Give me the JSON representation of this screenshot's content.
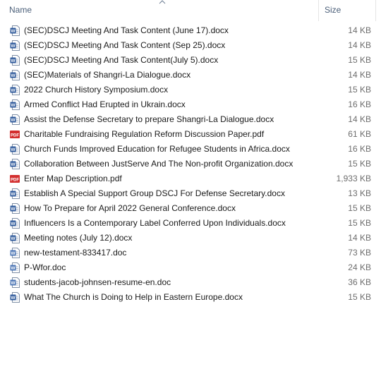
{
  "header": {
    "name_label": "Name",
    "size_label": "Size"
  },
  "files": [
    {
      "name": "(SEC)DSCJ Meeting And Task Content (June 17).docx",
      "size": "14 KB",
      "icon": "word-docx-icon"
    },
    {
      "name": "(SEC)DSCJ Meeting And Task Content (Sep 25).docx",
      "size": "14 KB",
      "icon": "word-docx-icon"
    },
    {
      "name": "(SEC)DSCJ Meeting And Task Content(July 5).docx",
      "size": "15 KB",
      "icon": "word-docx-icon"
    },
    {
      "name": "(SEC)Materials of Shangri-La Dialogue.docx",
      "size": "14 KB",
      "icon": "word-docx-icon"
    },
    {
      "name": "2022 Church History Symposium.docx",
      "size": "15 KB",
      "icon": "word-docx-icon"
    },
    {
      "name": "Armed Conflict Had Erupted in Ukrain.docx",
      "size": "16 KB",
      "icon": "word-docx-icon"
    },
    {
      "name": "Assist the Defense Secretary to prepare Shangri-La Dialogue.docx",
      "size": "14 KB",
      "icon": "word-docx-icon"
    },
    {
      "name": "Charitable Fundraising Regulation Reform Discussion Paper.pdf",
      "size": "61 KB",
      "icon": "pdf-icon"
    },
    {
      "name": "Church Funds Improved Education for Refugee Students in Africa.docx",
      "size": "16 KB",
      "icon": "word-docx-icon"
    },
    {
      "name": "Collaboration Between JustServe And The Non-profit Organization.docx",
      "size": "15 KB",
      "icon": "word-docx-icon"
    },
    {
      "name": "Enter Map Description.pdf",
      "size": "1,933 KB",
      "icon": "pdf-icon"
    },
    {
      "name": "Establish A Special Support Group DSCJ For Defense Secretary.docx",
      "size": "13 KB",
      "icon": "word-docx-icon"
    },
    {
      "name": "How To Prepare for April 2022 General Conference.docx",
      "size": "15 KB",
      "icon": "word-docx-icon"
    },
    {
      "name": "Influencers Is a Contemporary Label Conferred Upon Individuals.docx",
      "size": "15 KB",
      "icon": "word-docx-icon"
    },
    {
      "name": "Meeting notes (July 12).docx",
      "size": "14 KB",
      "icon": "word-docx-icon"
    },
    {
      "name": "new-testament-833417.doc",
      "size": "73 KB",
      "icon": "word-doc-icon"
    },
    {
      "name": "P-Wfor.doc",
      "size": "24 KB",
      "icon": "word-doc-icon"
    },
    {
      "name": "students-jacob-johnsen-resume-en.doc",
      "size": "36 KB",
      "icon": "word-doc-icon"
    },
    {
      "name": "What The Church is Doing to Help in Eastern Europe.docx",
      "size": "15 KB",
      "icon": "word-docx-icon"
    }
  ],
  "colors": {
    "word_blue": "#2b579a",
    "pdf_red": "#d32f2f",
    "header_text": "#4c607a",
    "size_text": "#6d6d6d"
  }
}
